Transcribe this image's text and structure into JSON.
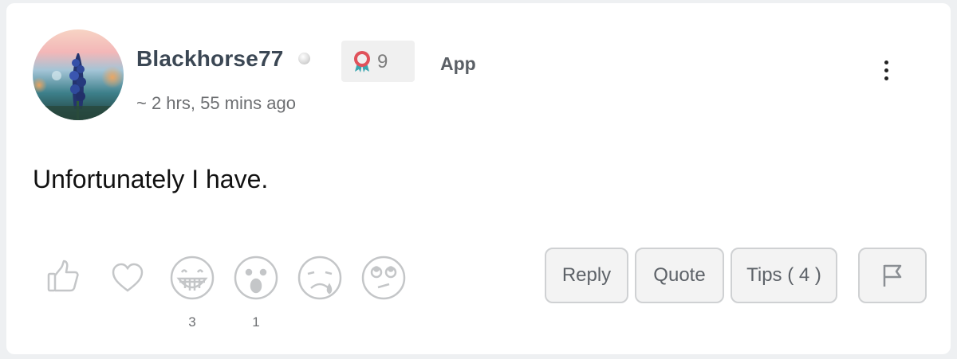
{
  "post": {
    "username": "Blackhorse77",
    "badge_count": "9",
    "source": "App",
    "timestamp": "~ 2 hrs, 55 mins ago",
    "body": "Unfortunately I have."
  },
  "reactions": {
    "grin_count": "3",
    "wow_count": "1"
  },
  "actions": {
    "reply": "Reply",
    "quote": "Quote",
    "tips": "Tips ( 4 )"
  },
  "icons": {
    "status": "online-status-dot",
    "badge": "award-ribbon-icon",
    "menu": "more-vertical-icon",
    "reactions": [
      "thumbs-up-icon",
      "heart-icon",
      "grin-icon",
      "surprised-icon",
      "sad-icon",
      "eye-roll-icon"
    ],
    "flag": "flag-icon"
  },
  "colors": {
    "accent": "#3b4754",
    "icon_gray": "#c4c6c8",
    "badge_red": "#e0525b",
    "badge_teal": "#3aa7b0"
  }
}
